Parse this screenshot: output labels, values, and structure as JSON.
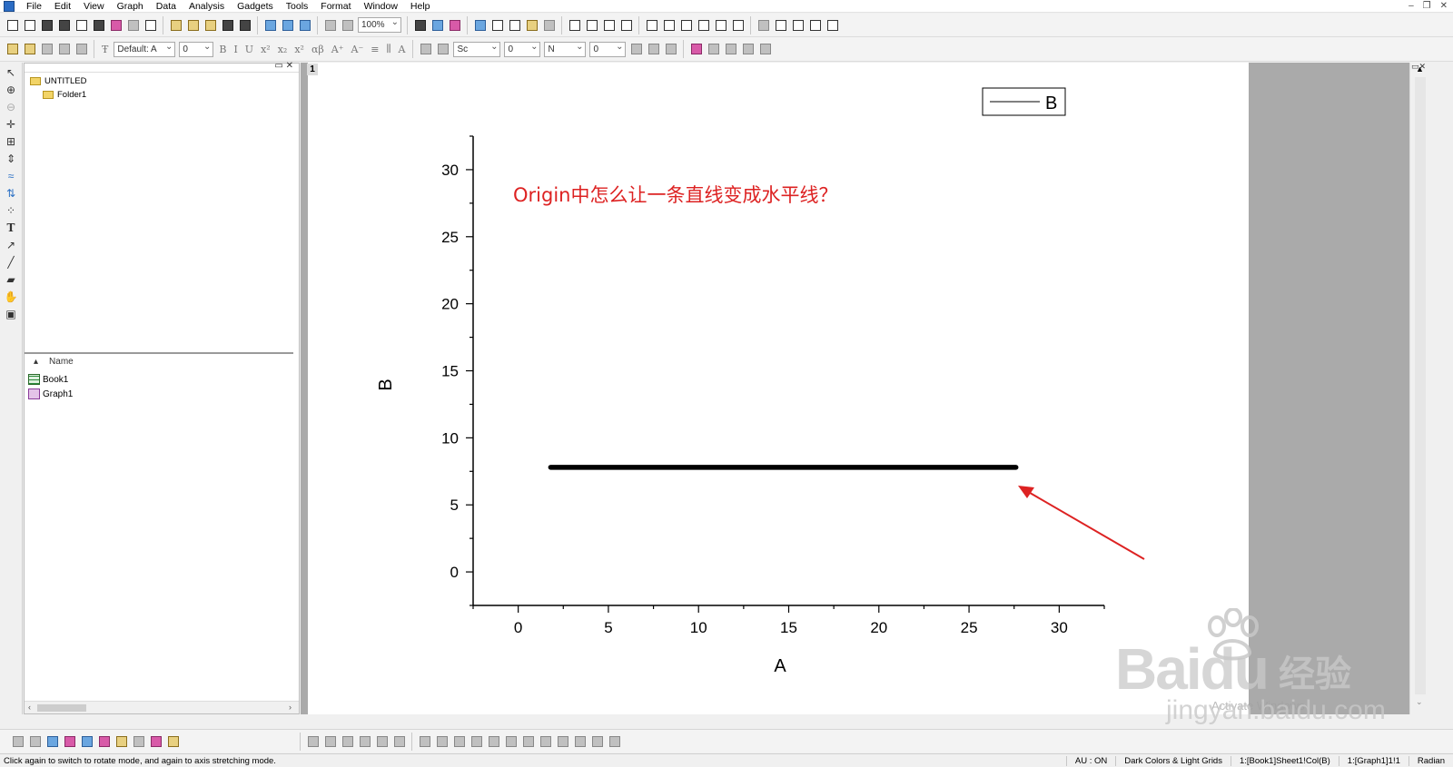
{
  "menu": {
    "items": [
      "File",
      "Edit",
      "View",
      "Graph",
      "Data",
      "Analysis",
      "Gadgets",
      "Tools",
      "Format",
      "Window",
      "Help"
    ]
  },
  "toolbar": {
    "zoom_value": "100%",
    "font_value": "Default: A",
    "font_size_value": "0",
    "line_style_value": "Sc",
    "line_width_value": "0",
    "fill_label": "N",
    "fill_value": "0"
  },
  "explorer": {
    "root_folder": "UNTITLED",
    "sub_folder": "Folder1",
    "list_header": "Name",
    "items": [
      "Book1",
      "Graph1"
    ]
  },
  "graph_window": {
    "page_number": "1"
  },
  "chart_data": {
    "type": "line",
    "annotation": "Origin中怎么让一条直线变成水平线？",
    "xlabel": "A",
    "ylabel": "B",
    "xlim": [
      -2.5,
      32.5
    ],
    "ylim": [
      -2.5,
      32.5
    ],
    "x_ticks": [
      0,
      5,
      10,
      15,
      20,
      25,
      30
    ],
    "y_ticks": [
      0,
      5,
      10,
      15,
      20,
      25,
      30
    ],
    "legend": "B",
    "legend_position": "top-right",
    "grid": false,
    "series": [
      {
        "name": "B",
        "x": [
          1.8,
          27.6
        ],
        "y": [
          7.8,
          7.8
        ]
      }
    ],
    "line_color": "#000000",
    "annotation_color": "#dd2222",
    "arrow_color": "#dd2222"
  },
  "statusbar": {
    "message": "Click again to switch to rotate mode, and again to axis stretching mode.",
    "au": "AU : ON",
    "theme": "Dark Colors & Light Grids",
    "book_ref": "1:[Book1]Sheet1!Col(B)",
    "graph_ref": "1:[Graph1]1!1",
    "angle_unit": "Radian"
  },
  "watermark": {
    "brand": "Baidu",
    "brand_cn": "经验",
    "site": "jingyan.baidu.com",
    "activate": "Activate Windows"
  }
}
